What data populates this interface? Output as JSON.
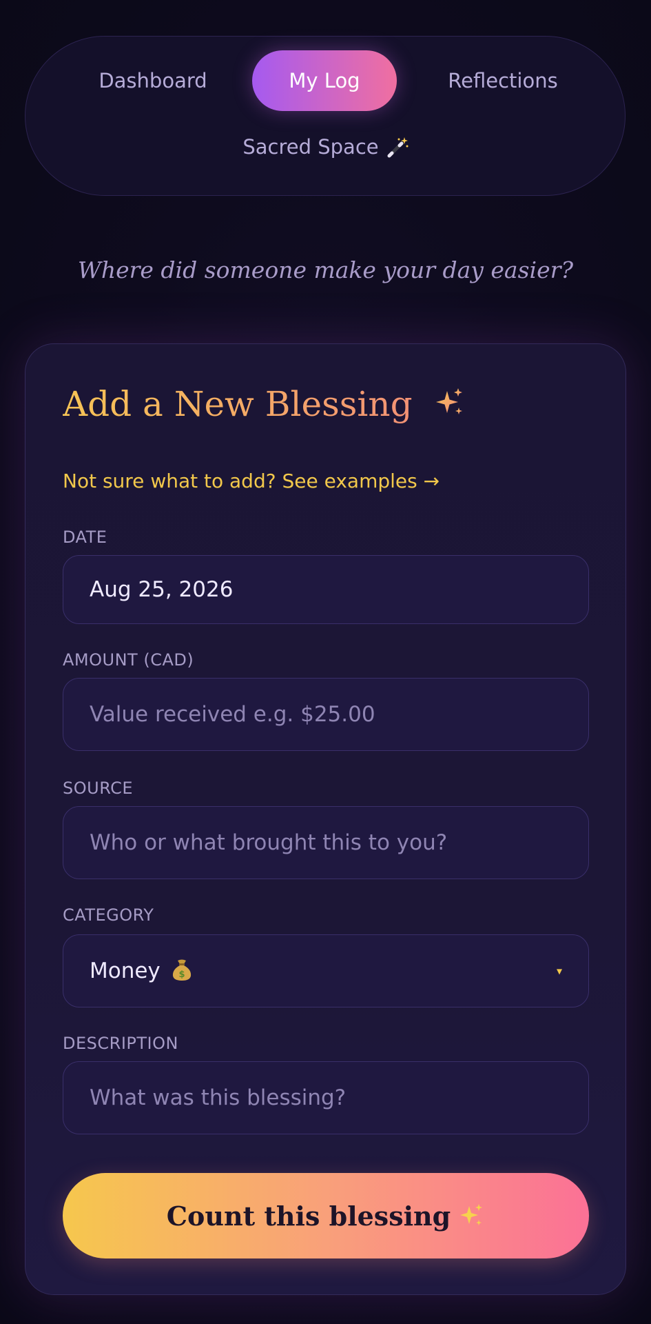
{
  "nav": {
    "tabs": [
      {
        "label": "Dashboard",
        "active": false
      },
      {
        "label": "My Log",
        "active": true
      },
      {
        "label": "Reflections",
        "active": false
      },
      {
        "label": "Sacred Space",
        "active": false,
        "icon": "magic-wand-icon"
      }
    ]
  },
  "tagline": "Where did someone make your day easier?",
  "form": {
    "title": "Add a New Blessing",
    "title_icon": "sparkles-icon",
    "examples_link": "Not sure what to add? See examples →",
    "date": {
      "label": "DATE",
      "value": "Aug 25, 2026"
    },
    "amount": {
      "label": "AMOUNT (CAD)",
      "value": "",
      "placeholder": "Value received e.g. $25.00"
    },
    "source": {
      "label": "SOURCE",
      "value": "",
      "placeholder": "Who or what brought this to you?"
    },
    "category": {
      "label": "CATEGORY",
      "value": "Money",
      "value_icon": "money-bag-icon",
      "caret": "▾"
    },
    "description": {
      "label": "DESCRIPTION",
      "value": "",
      "placeholder": "What was this blessing?"
    },
    "submit_label": "Count this blessing",
    "submit_icon": "sparkles-icon"
  },
  "colors": {
    "accent_gold": "#f2c84b",
    "accent_pink": "#f06fa0",
    "accent_purple": "#a55af0",
    "background": "#0e0b1e",
    "card": "#1b1535"
  }
}
